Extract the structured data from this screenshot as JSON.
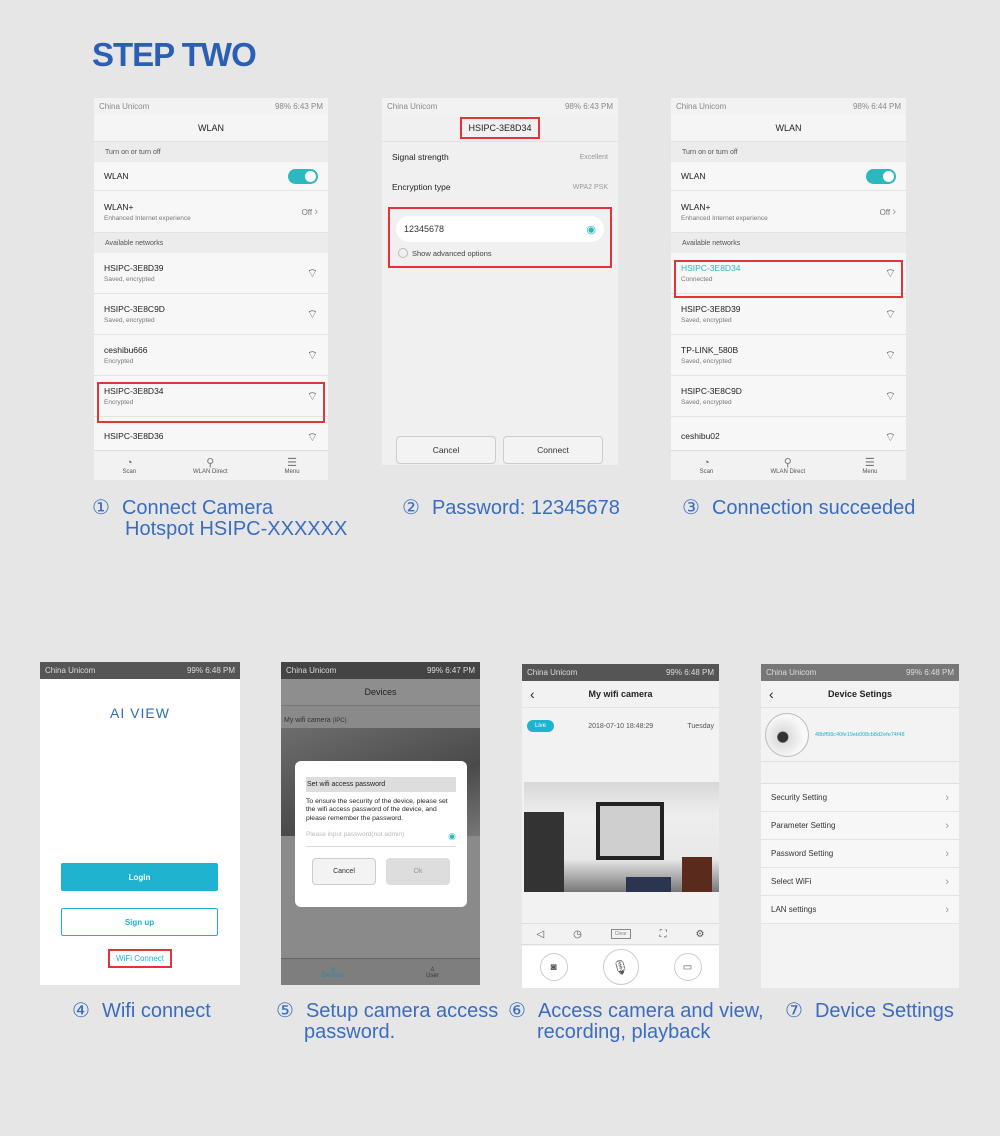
{
  "title": "STEP TWO",
  "status": {
    "carrier": "China Unicom",
    "p1": "98%  6:43 PM",
    "p2": "98%  6:43 PM",
    "p3": "98%  6:44 PM",
    "p4": "99%  6:48 PM",
    "p5": "99%  6:47 PM",
    "p6": "99%  6:48 PM",
    "p7": "99%  6:48 PM"
  },
  "wlan": {
    "title": "WLAN",
    "turn_section": "Turn on or turn off",
    "wlan_label": "WLAN",
    "wlan_on": true,
    "wlanplus": "WLAN+",
    "wlanplus_sub": "Enhanced Internet experience",
    "wlanplus_value": "Off",
    "available": "Available networks",
    "scan": "Scan",
    "direct": "WLAN Direct",
    "menu": "Menu",
    "networks1": [
      {
        "name": "HSIPC-3E8D39",
        "status": "Saved, encrypted"
      },
      {
        "name": "HSIPC-3E8C9D",
        "status": "Saved, encrypted"
      },
      {
        "name": "ceshibu666",
        "status": "Encrypted"
      },
      {
        "name": "HSIPC-3E8D34",
        "status": "Encrypted"
      },
      {
        "name": "HSIPC-3E8D36",
        "status": ""
      }
    ],
    "networks3": [
      {
        "name": "HSIPC-3E8D34",
        "status": "Connected"
      },
      {
        "name": "HSIPC-3E8D39",
        "status": "Saved, encrypted"
      },
      {
        "name": "TP-LINK_580B",
        "status": "Saved, encrypted"
      },
      {
        "name": "HSIPC-3E8C9D",
        "status": "Saved, encrypted"
      },
      {
        "name": "ceshibu02",
        "status": ""
      }
    ]
  },
  "connect": {
    "title": "HSIPC-3E8D34",
    "signal_label": "Signal strength",
    "signal_value": "Excellent",
    "enc_label": "Encryption type",
    "enc_value": "WPA2 PSK",
    "password": "12345678",
    "advanced": "Show advanced options",
    "cancel": "Cancel",
    "connect": "Connect"
  },
  "login": {
    "brand": "AI VIEW",
    "login": "Login",
    "signup": "Sign up",
    "wifi_connect": "WiFi Connect"
  },
  "devices": {
    "title": "Devices",
    "camera": "My wifi camera",
    "camera_type": "(IPC)",
    "dialog_title": "Set wifi access password",
    "dialog_text": "To ensure the security of the device, please set the wifi access password of the device, and please remember the password.",
    "placeholder": "Please input password(not admin)",
    "cancel": "Cancel",
    "ok": "Ok",
    "tab_devices": "Devices",
    "tab_user": "User"
  },
  "live": {
    "title": "My wifi camera",
    "badge": "Live",
    "datetime": "2018-07-10 18:48:29",
    "day": "Tuesday",
    "clear": "Clear"
  },
  "settings": {
    "title": "Device Setings",
    "device_id": "48bff98c40fe19eb008cb8d2efe74f48",
    "items": [
      "Security Setting",
      "Parameter Setting",
      "Password Setting",
      "Select WiFi",
      "LAN settings"
    ]
  },
  "captions": [
    {
      "num": "①",
      "text": "Connect Camera",
      "text2": "Hotspot HSIPC-XXXXXX"
    },
    {
      "num": "②",
      "text": "Password: 12345678"
    },
    {
      "num": "③",
      "text": "Connection succeeded"
    },
    {
      "num": "④",
      "text": "Wifi connect"
    },
    {
      "num": "⑤",
      "text": "Setup camera access",
      "text2": "password."
    },
    {
      "num": "⑥",
      "text": "Access camera and view,",
      "text2": "recording, playback"
    },
    {
      "num": "⑦",
      "text": "Device Settings"
    }
  ],
  "colors": {
    "accent": "#2bb9c0",
    "title": "#2b5fb4",
    "highlight": "#e2353a"
  }
}
